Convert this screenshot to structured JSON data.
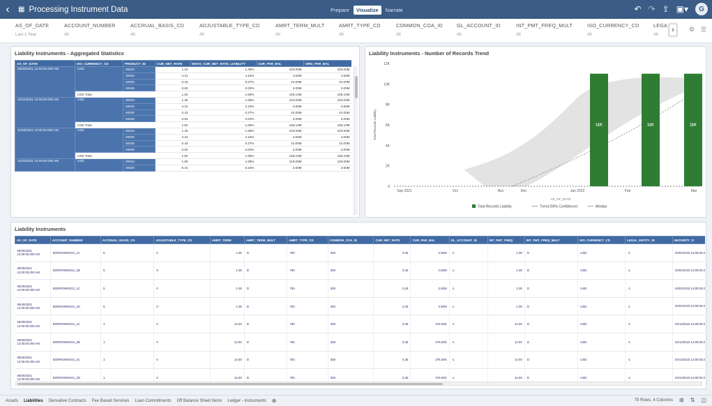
{
  "app": {
    "title": "Processing Instrument Data",
    "tabs": [
      {
        "label": "Prepare",
        "active": false
      },
      {
        "label": "Visualize",
        "active": true
      },
      {
        "label": "Narrate",
        "active": false
      }
    ],
    "avatar_initial": "G"
  },
  "filters": [
    {
      "name": "AS_OF_DATE",
      "value": "Last 1 Year"
    },
    {
      "name": "ACCOUNT_NUMBER",
      "value": "All"
    },
    {
      "name": "ACCRUAL_BASIS_CD",
      "value": "All"
    },
    {
      "name": "ADJUSTABLE_TYPE_CD",
      "value": "All"
    },
    {
      "name": "AMRT_TERM_MULT",
      "value": "All"
    },
    {
      "name": "AMRT_TYPE_CD",
      "value": "All"
    },
    {
      "name": "COMMON_COA_ID",
      "value": "All"
    },
    {
      "name": "GL_ACCOUNT_ID",
      "value": "All"
    },
    {
      "name": "INT_PMT_FREQ_MULT",
      "value": "All"
    },
    {
      "name": "ISO_CURRENCY_CD",
      "value": "All"
    },
    {
      "name": "LEGA",
      "value": "All"
    }
  ],
  "agg": {
    "title": "Liability Instruments - Aggregated Statistics",
    "headers": [
      "AS_OF_DATE",
      "ISO_CURRENCY_CD",
      "PRODUCT_ID",
      "CUR_NET_RATE",
      "WAVG_CUR_NET_RATE_LIABILITY",
      "CUR_PAR_BAL",
      "ORG_PAR_BAL"
    ],
    "groups": [
      {
        "date": "09/30/2021 12:00:00.000 AM",
        "iso": "USD",
        "rows": [
          [
            "20010",
            "1.24",
            "1.49%",
            "103.00M",
            "103.00M"
          ],
          [
            "20020",
            "4.31",
            "4.16%",
            "4.60M",
            "4.60M"
          ],
          [
            "20030",
            "0.43",
            "0.37%",
            "24.00M",
            "24.00M"
          ],
          [
            "20040",
            "0.63",
            "0.63%",
            "2.00M",
            "2.00M"
          ]
        ],
        "total": [
          "USD Total",
          "1.52",
          "1.58%",
          "156.10M",
          "156.10M"
        ]
      },
      {
        "date": "10/31/2021 12:00:00.000 AM",
        "iso": "USD",
        "rows": [
          [
            "20010",
            "1.26",
            "1.58%",
            "103.00M",
            "103.00M"
          ],
          [
            "20020",
            "4.31",
            "4.16%",
            "4.60M",
            "4.60M"
          ],
          [
            "20030",
            "0.43",
            "0.37%",
            "24.00M",
            "24.00M"
          ],
          [
            "20040",
            "0.63",
            "0.63%",
            "2.00M",
            "2.00M"
          ]
        ],
        "total": [
          "USD Total",
          "1.52",
          "1.58%",
          "156.10M",
          "156.10M"
        ]
      },
      {
        "date": "11/30/2021 12:00:00.000 AM",
        "iso": "USD",
        "rows": [
          [
            "20010",
            "1.26",
            "1.58%",
            "103.00M",
            "103.00M"
          ],
          [
            "20020",
            "4.31",
            "4.16%",
            "4.60M",
            "4.60M"
          ],
          [
            "20030",
            "0.43",
            "0.37%",
            "24.00M",
            "24.00M"
          ],
          [
            "20040",
            "0.63",
            "0.63%",
            "2.00M",
            "2.00M"
          ]
        ],
        "total": [
          "USD Total",
          "1.52",
          "1.58%",
          "156.10M",
          "156.10M"
        ]
      },
      {
        "date": "12/31/2021 12:00:00.000 AM",
        "iso": "USD",
        "rows": [
          [
            "20010",
            "1.69",
            "1.89%",
            "103.00M",
            "103.00M"
          ],
          [
            "20020",
            "6.31",
            "6.16%",
            "4.60M",
            "4.60M"
          ]
        ],
        "total": null
      }
    ]
  },
  "chart_data": {
    "type": "bar",
    "title": "Liability Instruments - Number of Records Trend",
    "xlabel": "AS_OF_DATE",
    "ylabel": "Total Records Liability",
    "x_ticks": [
      "Sep 2021",
      "Oct",
      "Nov",
      "Dec",
      "Jan 2022",
      "Feb",
      "Mar"
    ],
    "y_ticks": [
      "0",
      "2K",
      "4K",
      "6K",
      "8K",
      "10K",
      "12K"
    ],
    "ylim": [
      0,
      12000
    ],
    "categories": [
      "Sep 2021",
      "Oct",
      "Nov",
      "Dec",
      "Jan 2022",
      "Feb",
      "Mar"
    ],
    "series": [
      {
        "name": "Total Records Liability",
        "values": [
          0,
          0,
          0,
          0,
          0,
          11000,
          11000,
          11000
        ],
        "points": [
          [
            "Sep 2021",
            0
          ],
          [
            "Oct",
            0
          ],
          [
            "Nov",
            0
          ],
          [
            "Dec",
            0
          ],
          [
            "Jan 2022",
            0
          ],
          [
            "Jan 2022 (late)",
            11000
          ],
          [
            "Feb",
            11000
          ],
          [
            "Mar",
            11000
          ]
        ],
        "bar_labels": [
          "11K",
          "11K",
          "11K"
        ],
        "color": "#2e7d32"
      }
    ],
    "bars": [
      {
        "x": "Jan 2022 (late)",
        "value": 11000,
        "label": "11K"
      },
      {
        "x": "Feb (late)",
        "value": 11000,
        "label": "11K"
      },
      {
        "x": "Mar",
        "value": 11000,
        "label": "11K"
      }
    ],
    "trend": {
      "name": "Trend (95% Confidence)",
      "from": 0,
      "to": 9500
    },
    "median": {
      "name": "Median",
      "value": 0
    },
    "legend": [
      "Total Records Liability",
      "Trend (95% Confidence)",
      "Median"
    ],
    "legend_position": "bottom",
    "grid": false
  },
  "li": {
    "title": "Liability Instruments",
    "headers": [
      "AS_OF_DATE",
      "ACCOUNT_NUMBER",
      "ACCRUAL_BASIS_CD",
      "ADJUSTABLE_TYPE_CD",
      "AMRT_TERM",
      "AMRT_TERM_MULT",
      "AMRT_TYPE_CD",
      "COMMON_COA_ID",
      "CUR_NET_RATE",
      "CUR_PAR_BAL",
      "GL_ACCOUNT_ID",
      "INT_PMT_FREQ",
      "INT_PMT_FREQ_MULT",
      "ISO_CURRENCY_CD",
      "LEGAL_ENTITY_ID",
      "MATURITY_D"
    ],
    "rows": [
      [
        "09/30/2021 12:00:00.000 AM",
        "BORROWINGS_1A",
        "5",
        "0",
        "1.00",
        "D",
        "700",
        "300",
        "0.25",
        "2.50M",
        "-1",
        "1.00",
        "D",
        "USD",
        "-1",
        "04/01/2015 12:00:00.000 A"
      ],
      [
        "09/30/2021 12:00:00.000 AM",
        "BORROWINGS_1B",
        "5",
        "0",
        "1.00",
        "D",
        "700",
        "300",
        "0.25",
        "2.50M",
        "-1",
        "1.00",
        "D",
        "USD",
        "-1",
        "04/01/2015 12:00:00.000 A"
      ],
      [
        "09/30/2021 12:00:00.000 AM",
        "BORROWINGS_1C",
        "5",
        "0",
        "1.00",
        "D",
        "700",
        "300",
        "0.25",
        "2.50M",
        "-1",
        "1.00",
        "D",
        "USD",
        "-1",
        "04/01/2015 12:00:00.000 A"
      ],
      [
        "09/30/2021 12:00:00.000 AM",
        "BORROWINGS_1D",
        "5",
        "0",
        "1.00",
        "D",
        "700",
        "300",
        "0.25",
        "2.50M",
        "-1",
        "1.00",
        "D",
        "USD",
        "-1",
        "04/01/2015 12:00:00.000 A"
      ],
      [
        "09/30/2021 12:00:00.000 AM",
        "BORROWINGS_2A",
        "1",
        "0",
        "14.00",
        "D",
        "700",
        "300",
        "0.35",
        "375.00K",
        "-1",
        "14.00",
        "D",
        "USD",
        "-1",
        "04/14/2015 12:00:00.000 A"
      ],
      [
        "09/30/2021 12:00:00.000 AM",
        "BORROWINGS_2B",
        "1",
        "0",
        "14.00",
        "D",
        "700",
        "300",
        "0.35",
        "375.00K",
        "-1",
        "14.00",
        "D",
        "USD",
        "-1",
        "04/14/2015 12:00:00.000 A"
      ],
      [
        "09/30/2021 12:00:00.000 AM",
        "BORROWINGS_2C",
        "1",
        "0",
        "14.00",
        "D",
        "700",
        "300",
        "0.35",
        "375.00K",
        "-1",
        "14.00",
        "D",
        "USD",
        "-1",
        "04/14/2015 12:00:00.000 A"
      ],
      [
        "09/30/2021 12:00:00.000 AM",
        "BORROWINGS_2D",
        "1",
        "0",
        "14.00",
        "D",
        "700",
        "300",
        "0.35",
        "375.00K",
        "-1",
        "14.00",
        "D",
        "USD",
        "-1",
        "04/14/2015 12:00:00.000 A"
      ]
    ]
  },
  "footer": {
    "tabs": [
      {
        "label": "Assets",
        "active": false
      },
      {
        "label": "Liabilities",
        "active": true
      },
      {
        "label": "Derivative Contracts",
        "active": false
      },
      {
        "label": "Fee Based Services",
        "active": false
      },
      {
        "label": "Loan Commitments",
        "active": false
      },
      {
        "label": "Off Balance Sheet Items",
        "active": false
      },
      {
        "label": "Ledger - Instruments",
        "active": false
      }
    ],
    "status": "79 Rows, 4 Columns"
  }
}
